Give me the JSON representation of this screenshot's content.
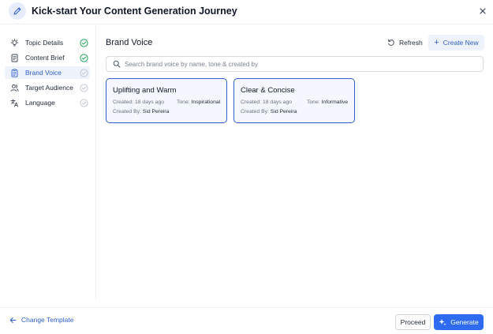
{
  "header": {
    "title": "Kick-start Your Content Generation Journey",
    "icon": "pen-icon",
    "close_icon": "close-icon"
  },
  "sidebar": {
    "steps": [
      {
        "label": "Topic Details",
        "icon": "lightbulb-icon",
        "status": "complete"
      },
      {
        "label": "Content Brief",
        "icon": "document-icon",
        "status": "complete"
      },
      {
        "label": "Brand Voice",
        "icon": "clipboard-icon",
        "status": "active"
      },
      {
        "label": "Target Audience",
        "icon": "users-icon",
        "status": "pending"
      },
      {
        "label": "Language",
        "icon": "translate-icon",
        "status": "pending"
      }
    ]
  },
  "main": {
    "heading": "Brand Voice",
    "refresh_label": "Refresh",
    "create_label": "Create New",
    "search_placeholder": "Search brand voice by name, tone & created by",
    "cards": [
      {
        "name": "Uplifting and Warm",
        "created_label": "Created:",
        "created_value": "18 days ago",
        "tone_label": "Tone:",
        "tone_value": "Inspirational",
        "created_by_label": "Created By:",
        "created_by_value": "Sid Pereira"
      },
      {
        "name": "Clear & Concise",
        "created_label": "Created:",
        "created_value": "18 days ago",
        "tone_label": "Tone:",
        "tone_value": "Informative",
        "created_by_label": "Created By:",
        "created_by_value": "Sid Pereira"
      }
    ]
  },
  "footer": {
    "change_template_label": "Change Template",
    "proceed_label": "Proceed",
    "generate_label": "Generate"
  },
  "colors": {
    "accent": "#2f5fd0",
    "primary_button": "#2f6bf0",
    "complete_check": "#22a356",
    "pending_check": "#c3c8d0"
  }
}
